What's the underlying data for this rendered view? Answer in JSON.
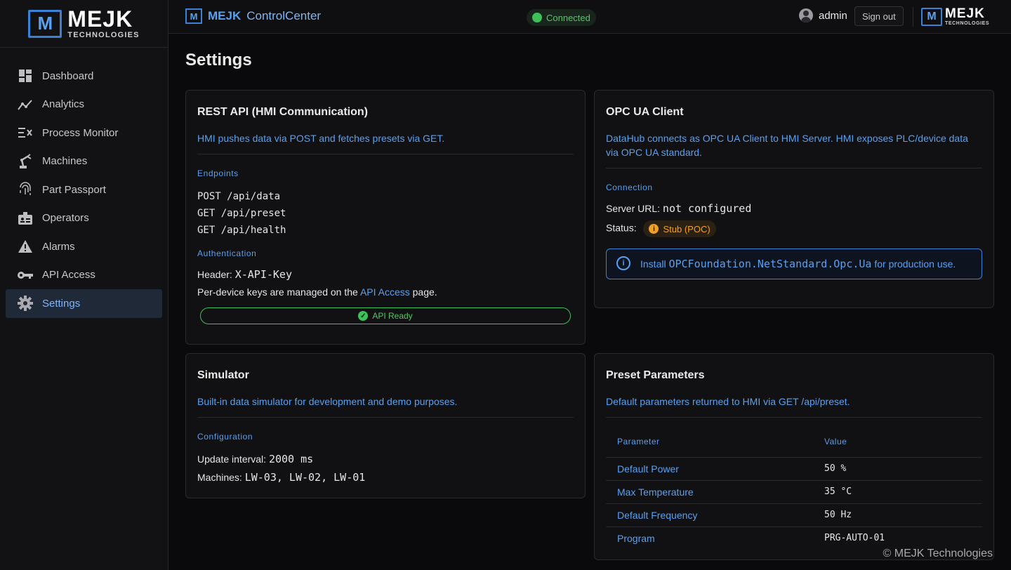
{
  "brand": {
    "name": "MEJK",
    "sub": "TECHNOLOGIES",
    "glyph": "M"
  },
  "header": {
    "brand": "MEJK",
    "app": "ControlCenter",
    "status": "Connected",
    "user": "admin",
    "signout": "Sign out"
  },
  "sidebar": {
    "items": [
      {
        "label": "Dashboard",
        "icon": "dashboard-icon"
      },
      {
        "label": "Analytics",
        "icon": "analytics-icon"
      },
      {
        "label": "Process Monitor",
        "icon": "process-monitor-icon"
      },
      {
        "label": "Machines",
        "icon": "robot-arm-icon"
      },
      {
        "label": "Part Passport",
        "icon": "fingerprint-icon"
      },
      {
        "label": "Operators",
        "icon": "badge-icon"
      },
      {
        "label": "Alarms",
        "icon": "warning-icon"
      },
      {
        "label": "API Access",
        "icon": "key-icon"
      },
      {
        "label": "Settings",
        "icon": "gear-icon",
        "active": true
      }
    ]
  },
  "page": {
    "title": "Settings"
  },
  "rest": {
    "title": "REST API (HMI Communication)",
    "desc": "HMI pushes data via POST and fetches presets via GET.",
    "endpoints_label": "Endpoints",
    "endpoints": [
      "POST /api/data",
      "GET /api/preset",
      "GET /api/health"
    ],
    "auth_label": "Authentication",
    "header_label": "Header:",
    "header_value": "X-API-Key",
    "keys_pre": "Per-device keys are managed on the",
    "keys_link": "API Access",
    "keys_post": "page.",
    "ready": "API Ready"
  },
  "opc": {
    "title": "OPC UA Client",
    "desc": "DataHub connects as OPC UA Client to HMI Server. HMI exposes PLC/device data via OPC UA standard.",
    "conn_label": "Connection",
    "url_label": "Server URL:",
    "url_value": "not configured",
    "status_label": "Status:",
    "status_value": "Stub (POC)",
    "info_pre": "Install",
    "info_pkg": "OPCFoundation.NetStandard.Opc.Ua",
    "info_post": "for production use."
  },
  "sim": {
    "title": "Simulator",
    "desc": "Built-in data simulator for development and demo purposes.",
    "config_label": "Configuration",
    "interval_label": "Update interval:",
    "interval_value": "2000 ms",
    "machines_label": "Machines:",
    "machines_value": "LW-03, LW-02, LW-01"
  },
  "preset": {
    "title": "Preset Parameters",
    "desc": "Default parameters returned to HMI via GET /api/preset.",
    "col_param": "Parameter",
    "col_value": "Value",
    "rows": [
      {
        "name": "Default Power",
        "value": "50 %"
      },
      {
        "name": "Max Temperature",
        "value": "35 °C"
      },
      {
        "name": "Default Frequency",
        "value": "50 Hz"
      },
      {
        "name": "Program",
        "value": "PRG-AUTO-01"
      }
    ]
  },
  "footer": "© MEJK Technologies"
}
